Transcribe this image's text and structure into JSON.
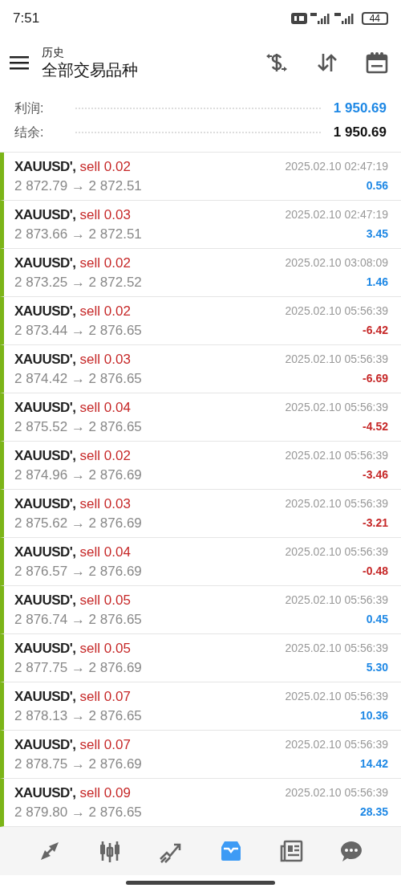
{
  "status_bar": {
    "time": "7:51",
    "battery": "44"
  },
  "header": {
    "subtitle": "历史",
    "title": "全部交易品种"
  },
  "summary": [
    {
      "label": "利润:",
      "value": "1 950.69",
      "kind": "profit"
    },
    {
      "label": "结余:",
      "value": "1 950.69",
      "kind": "balance"
    }
  ],
  "trades": [
    {
      "symbol": "XAUUSD',",
      "order": "sell 0.02",
      "time": "2025.02.10 02:47:19",
      "prices": "2 872.79 → 2 872.51",
      "result": "0.56",
      "color": "#1e88e5"
    },
    {
      "symbol": "XAUUSD',",
      "order": "sell 0.03",
      "time": "2025.02.10 02:47:19",
      "prices": "2 873.66 → 2 872.51",
      "result": "3.45",
      "color": "#1e88e5"
    },
    {
      "symbol": "XAUUSD',",
      "order": "sell 0.02",
      "time": "2025.02.10 03:08:09",
      "prices": "2 873.25 → 2 872.52",
      "result": "1.46",
      "color": "#1e88e5"
    },
    {
      "symbol": "XAUUSD',",
      "order": "sell 0.02",
      "time": "2025.02.10 05:56:39",
      "prices": "2 873.44 → 2 876.65",
      "result": "-6.42",
      "color": "#c62828"
    },
    {
      "symbol": "XAUUSD',",
      "order": "sell 0.03",
      "time": "2025.02.10 05:56:39",
      "prices": "2 874.42 → 2 876.65",
      "result": "-6.69",
      "color": "#c62828"
    },
    {
      "symbol": "XAUUSD',",
      "order": "sell 0.04",
      "time": "2025.02.10 05:56:39",
      "prices": "2 875.52 → 2 876.65",
      "result": "-4.52",
      "color": "#c62828"
    },
    {
      "symbol": "XAUUSD',",
      "order": "sell 0.02",
      "time": "2025.02.10 05:56:39",
      "prices": "2 874.96 → 2 876.69",
      "result": "-3.46",
      "color": "#c62828"
    },
    {
      "symbol": "XAUUSD',",
      "order": "sell 0.03",
      "time": "2025.02.10 05:56:39",
      "prices": "2 875.62 → 2 876.69",
      "result": "-3.21",
      "color": "#c62828"
    },
    {
      "symbol": "XAUUSD',",
      "order": "sell 0.04",
      "time": "2025.02.10 05:56:39",
      "prices": "2 876.57 → 2 876.69",
      "result": "-0.48",
      "color": "#c62828"
    },
    {
      "symbol": "XAUUSD',",
      "order": "sell 0.05",
      "time": "2025.02.10 05:56:39",
      "prices": "2 876.74 → 2 876.65",
      "result": "0.45",
      "color": "#1e88e5"
    },
    {
      "symbol": "XAUUSD',",
      "order": "sell 0.05",
      "time": "2025.02.10 05:56:39",
      "prices": "2 877.75 → 2 876.69",
      "result": "5.30",
      "color": "#1e88e5"
    },
    {
      "symbol": "XAUUSD',",
      "order": "sell 0.07",
      "time": "2025.02.10 05:56:39",
      "prices": "2 878.13 → 2 876.65",
      "result": "10.36",
      "color": "#1e88e5"
    },
    {
      "symbol": "XAUUSD',",
      "order": "sell 0.07",
      "time": "2025.02.10 05:56:39",
      "prices": "2 878.75 → 2 876.69",
      "result": "14.42",
      "color": "#1e88e5"
    },
    {
      "symbol": "XAUUSD',",
      "order": "sell 0.09",
      "time": "2025.02.10 05:56:39",
      "prices": "2 879.80 → 2 876.65",
      "result": "28.35",
      "color": "#1e88e5"
    }
  ],
  "nav": [
    {
      "kind": "trade",
      "selected": false
    },
    {
      "kind": "quotes",
      "selected": false
    },
    {
      "kind": "chart",
      "selected": false
    },
    {
      "kind": "history",
      "selected": true
    },
    {
      "kind": "news",
      "selected": false
    },
    {
      "kind": "chat",
      "selected": false
    }
  ]
}
